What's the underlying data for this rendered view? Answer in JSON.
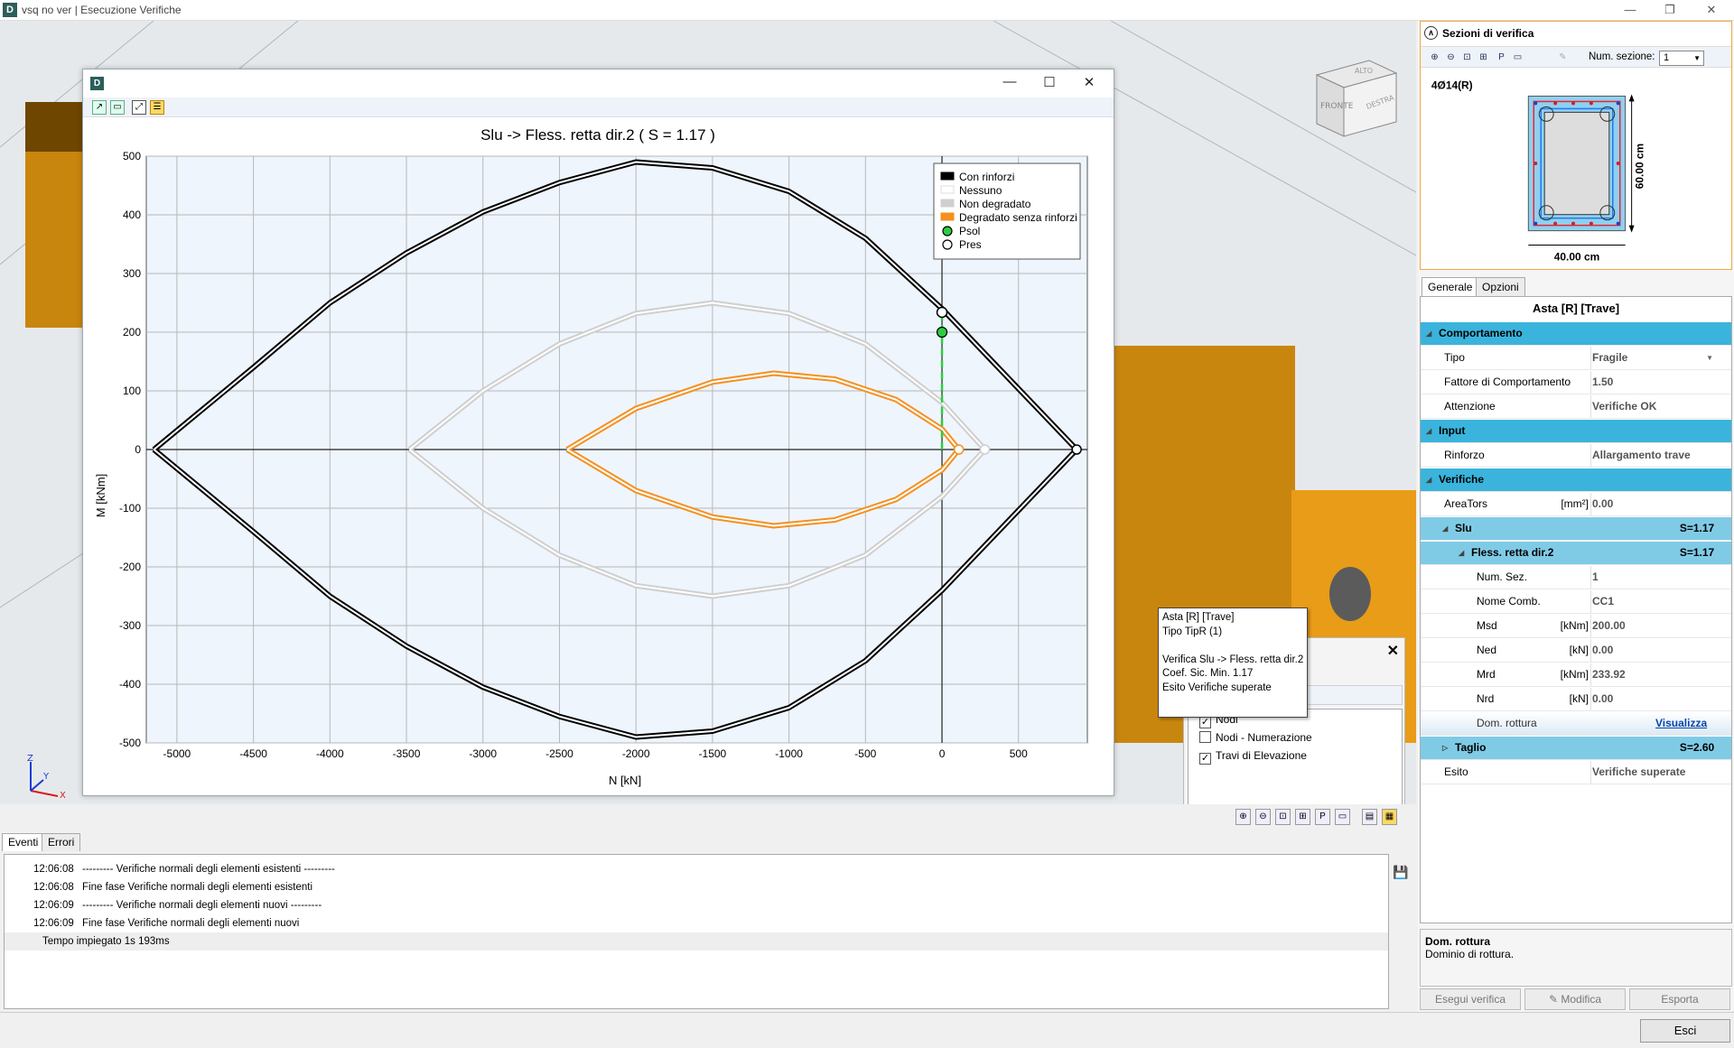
{
  "window": {
    "title": "vsq no ver | Esecuzione Verifiche",
    "app_icon": "D"
  },
  "viewcube": {
    "top": "ALTO",
    "front": "FRONTE",
    "right": "DESTRA"
  },
  "plot_window": {
    "icon": "D",
    "chart_data": {
      "type": "line",
      "title": "Slu -> Fless. retta dir.2 ( S = 1.17 )",
      "xlabel": "N [kN]",
      "ylabel": "M [kNm]",
      "xlim": [
        -5200,
        950
      ],
      "ylim": [
        -500,
        500
      ],
      "xticks": [
        -5000,
        -4500,
        -4000,
        -3500,
        -3000,
        -2500,
        -2000,
        -1500,
        -1000,
        -500,
        0,
        500
      ],
      "yticks": [
        500,
        400,
        300,
        200,
        100,
        0,
        -100,
        -200,
        -300,
        -400,
        -500
      ],
      "grid": true,
      "legend_position": "top-right",
      "legend": [
        {
          "label": "Con rinforzi",
          "color": "#000000",
          "kind": "line"
        },
        {
          "label": "Nessuno",
          "color": "#ffffff",
          "kind": "line"
        },
        {
          "label": "Non degradato",
          "color": "#cfcfcf",
          "kind": "line"
        },
        {
          "label": "Degradato senza rinforzi",
          "color": "#f5901e",
          "kind": "line"
        },
        {
          "label": "Psol",
          "color": "#2ecc40",
          "kind": "point"
        },
        {
          "label": "Pres",
          "color": "#ffffff",
          "kind": "point"
        }
      ],
      "series": [
        {
          "name": "Con rinforzi",
          "color": "#000000",
          "points": [
            [
              -5150,
              0
            ],
            [
              -4500,
              140
            ],
            [
              -4000,
              250
            ],
            [
              -3500,
              335
            ],
            [
              -3000,
              405
            ],
            [
              -2500,
              455
            ],
            [
              -2000,
              490
            ],
            [
              -1500,
              480
            ],
            [
              -1000,
              440
            ],
            [
              -500,
              360
            ],
            [
              0,
              240
            ],
            [
              880,
              0
            ],
            [
              0,
              -240
            ],
            [
              -500,
              -360
            ],
            [
              -1000,
              -440
            ],
            [
              -1500,
              -480
            ],
            [
              -2000,
              -490
            ],
            [
              -2500,
              -455
            ],
            [
              -3000,
              -405
            ],
            [
              -3500,
              -335
            ],
            [
              -4000,
              -250
            ],
            [
              -4500,
              -140
            ],
            [
              -5150,
              0
            ]
          ]
        },
        {
          "name": "Non degradato",
          "color": "#cfcfcf",
          "points": [
            [
              -3480,
              0
            ],
            [
              -3000,
              100
            ],
            [
              -2500,
              180
            ],
            [
              -2000,
              232
            ],
            [
              -1500,
              250
            ],
            [
              -1000,
              232
            ],
            [
              -500,
              180
            ],
            [
              0,
              80
            ],
            [
              280,
              0
            ],
            [
              0,
              -80
            ],
            [
              -500,
              -180
            ],
            [
              -1000,
              -232
            ],
            [
              -1500,
              -250
            ],
            [
              -2000,
              -232
            ],
            [
              -2500,
              -180
            ],
            [
              -3000,
              -100
            ],
            [
              -3480,
              0
            ]
          ]
        },
        {
          "name": "Degradato senza rinforzi",
          "color": "#f5901e",
          "points": [
            [
              -2450,
              0
            ],
            [
              -2000,
              70
            ],
            [
              -1500,
              115
            ],
            [
              -1100,
              130
            ],
            [
              -700,
              120
            ],
            [
              -300,
              85
            ],
            [
              0,
              35
            ],
            [
              110,
              0
            ],
            [
              0,
              -35
            ],
            [
              -300,
              -85
            ],
            [
              -700,
              -120
            ],
            [
              -1100,
              -130
            ],
            [
              -1500,
              -115
            ],
            [
              -2000,
              -70
            ],
            [
              -2450,
              0
            ]
          ]
        }
      ],
      "psol": [
        0,
        200
      ],
      "pres": [
        0,
        233.92
      ],
      "extra_points": [
        [
          880,
          0
        ],
        [
          110,
          0
        ],
        [
          280,
          0
        ]
      ]
    }
  },
  "tooltip": {
    "lines": [
      "Asta [R] [Trave]",
      "Tipo TipR (1)",
      "",
      "Verifica Slu -> Fless. retta dir.2",
      "Coef. Sic. Min. 1.17",
      "Esito Verifiche superate"
    ]
  },
  "layers": {
    "items": [
      {
        "label": "Nodi",
        "checked": true
      },
      {
        "label": "Nodi - Numerazione",
        "checked": false
      },
      {
        "label": "Travi di Elevazione",
        "checked": true
      }
    ]
  },
  "axes_gizmo": {
    "z": "Z",
    "y": "Y",
    "x": "X"
  },
  "bottom": {
    "tabs": [
      "Eventi",
      "Errori"
    ],
    "log": [
      {
        "time": "12:06:08",
        "msg": "--------- Verifiche normali degli elementi esistenti ---------"
      },
      {
        "time": "12:06:08",
        "msg": "Fine fase Verifiche normali degli elementi esistenti"
      },
      {
        "time": "12:06:09",
        "msg": "--------- Verifiche normali degli elementi nuovi ---------"
      },
      {
        "time": "12:06:09",
        "msg": "Fine fase Verifiche normali degli elementi nuovi"
      }
    ],
    "summary": "Tempo impiegato 1s 193ms"
  },
  "right": {
    "sezioni_title": "Sezioni di verifica",
    "num_sezione_label": "Num. sezione:",
    "num_sezione_value": "1",
    "section_label": "4Ø14(R)",
    "height_dim": "60.00 cm",
    "width_dim": "40.00 cm",
    "tabs": [
      "Generale",
      "Opzioni"
    ],
    "grid_title": "Asta [R] [Trave]",
    "rows": [
      {
        "type": "cat",
        "name": "Comportamento"
      },
      {
        "type": "prop",
        "name": "Tipo",
        "value": "Fragile",
        "dropdown": true
      },
      {
        "type": "prop",
        "name": "Fattore di Comportamento",
        "value": "1.50"
      },
      {
        "type": "prop",
        "name": "Attenzione",
        "value": "Verifiche OK"
      },
      {
        "type": "cat",
        "name": "Input"
      },
      {
        "type": "prop",
        "name": "Rinforzo",
        "value": "Allargamento trave"
      },
      {
        "type": "cat",
        "name": "Verifiche"
      },
      {
        "type": "prop",
        "name": "AreaTors",
        "unit": "[mm²]",
        "value": "0.00"
      },
      {
        "type": "sub1",
        "name": "Slu",
        "s": "S=1.17"
      },
      {
        "type": "sub2",
        "name": "Fless. retta dir.2",
        "s": "S=1.17"
      },
      {
        "type": "prop2",
        "name": "Num. Sez.",
        "value": "1"
      },
      {
        "type": "prop2",
        "name": "Nome Comb.",
        "value": "CC1"
      },
      {
        "type": "prop2",
        "name": "Msd",
        "unit": "[kNm]",
        "value": "200.00"
      },
      {
        "type": "prop2",
        "name": "Ned",
        "unit": "[kN]",
        "value": "0.00"
      },
      {
        "type": "prop2",
        "name": "Mrd",
        "unit": "[kNm]",
        "value": "233.92"
      },
      {
        "type": "prop2",
        "name": "Nrd",
        "unit": "[kN]",
        "value": "0.00"
      },
      {
        "type": "link",
        "name": "Dom. rottura",
        "value": "Visualizza"
      },
      {
        "type": "sub1c",
        "name": "Taglio",
        "s": "S=2.60"
      },
      {
        "type": "prop",
        "name": "Esito",
        "value": "Verifiche superate"
      }
    ],
    "desc_title": "Dom. rottura",
    "desc_text": "Dominio di rottura.",
    "buttons": [
      "Esegui verifica",
      "Modifica",
      "Esporta"
    ]
  },
  "footer": {
    "exit": "Esci"
  }
}
